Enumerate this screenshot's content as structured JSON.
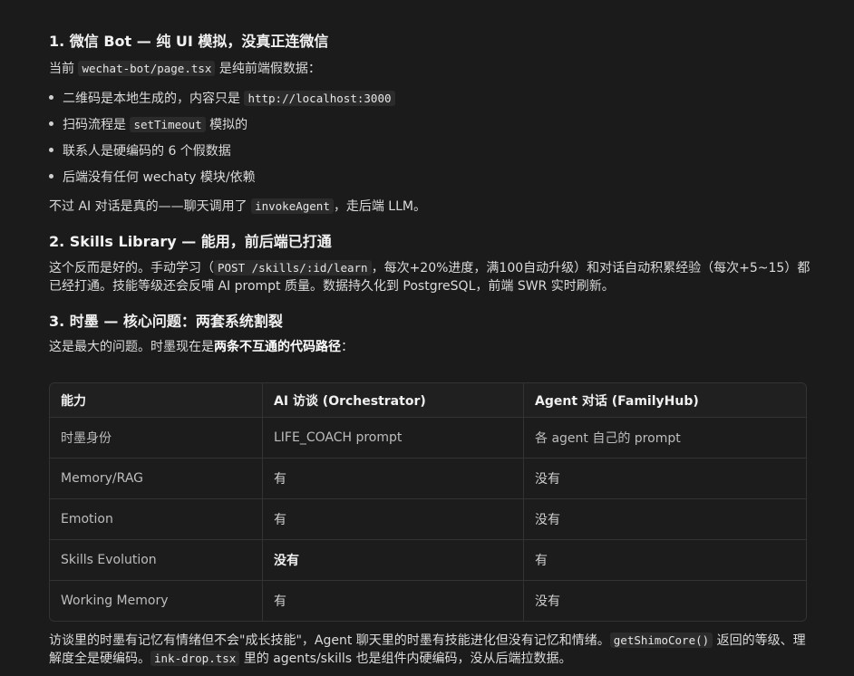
{
  "s1": {
    "heading": "1. 微信 Bot — 纯 UI 模拟，没真正连微信",
    "intro_pre": "当前 ",
    "intro_code": "wechat-bot/page.tsx",
    "intro_post": " 是纯前端假数据：",
    "b1_pre": "二维码是本地生成的，内容只是 ",
    "b1_code": "http://localhost:3000",
    "b2_pre": "扫码流程是 ",
    "b2_code": "setTimeout",
    "b2_post": " 模拟的",
    "b3": "联系人是硬编码的 6 个假数据",
    "b4": "后端没有任何 wechaty 模块/依赖",
    "outro_pre": "不过 AI 对话是真的——聊天调用了 ",
    "outro_code": "invokeAgent",
    "outro_post": "，走后端 LLM。"
  },
  "s2": {
    "heading": "2. Skills Library — 能用，前后端已打通",
    "p_pre": "这个反而是好的。手动学习（",
    "p_code": "POST /skills/:id/learn",
    "p_post": "，每次+20%进度，满100自动升级）和对话自动积累经验（每次+5~15）都已经打通。技能等级还会反哺 AI prompt 质量。数据持久化到 PostgreSQL，前端 SWR 实时刷新。"
  },
  "s3": {
    "heading": "3. 时墨 — 核心问题：两套系统割裂",
    "p_pre": "这是最大的问题。时墨现在是",
    "p_bold": "两条不互通的代码路径",
    "p_post": "："
  },
  "table": {
    "headers": [
      "能力",
      "AI 访谈 (Orchestrator)",
      "Agent 对话 (FamilyHub)"
    ],
    "rows": [
      [
        "时墨身份",
        "LIFE_COACH prompt",
        "各 agent 自己的 prompt"
      ],
      [
        "Memory/RAG",
        "有",
        "没有"
      ],
      [
        "Emotion",
        "有",
        "没有"
      ],
      [
        "Skills Evolution",
        "没有",
        "有"
      ],
      [
        "Working Memory",
        "有",
        "没有"
      ]
    ]
  },
  "footer": {
    "p1_pre": "访谈里的时墨有记忆有情绪但不会\"成长技能\"，Agent 聊天里的时墨有技能进化但没有记忆和情绪。",
    "p1_code": "getShimoCore()",
    "p1_post": " 返回的等级、理",
    "p2_pre": "解度全是硬编码。",
    "p2_code": "ink-drop.tsx",
    "p2_post": " 里的 agents/skills 也是组件内硬编码，没从后端拉数据。"
  }
}
